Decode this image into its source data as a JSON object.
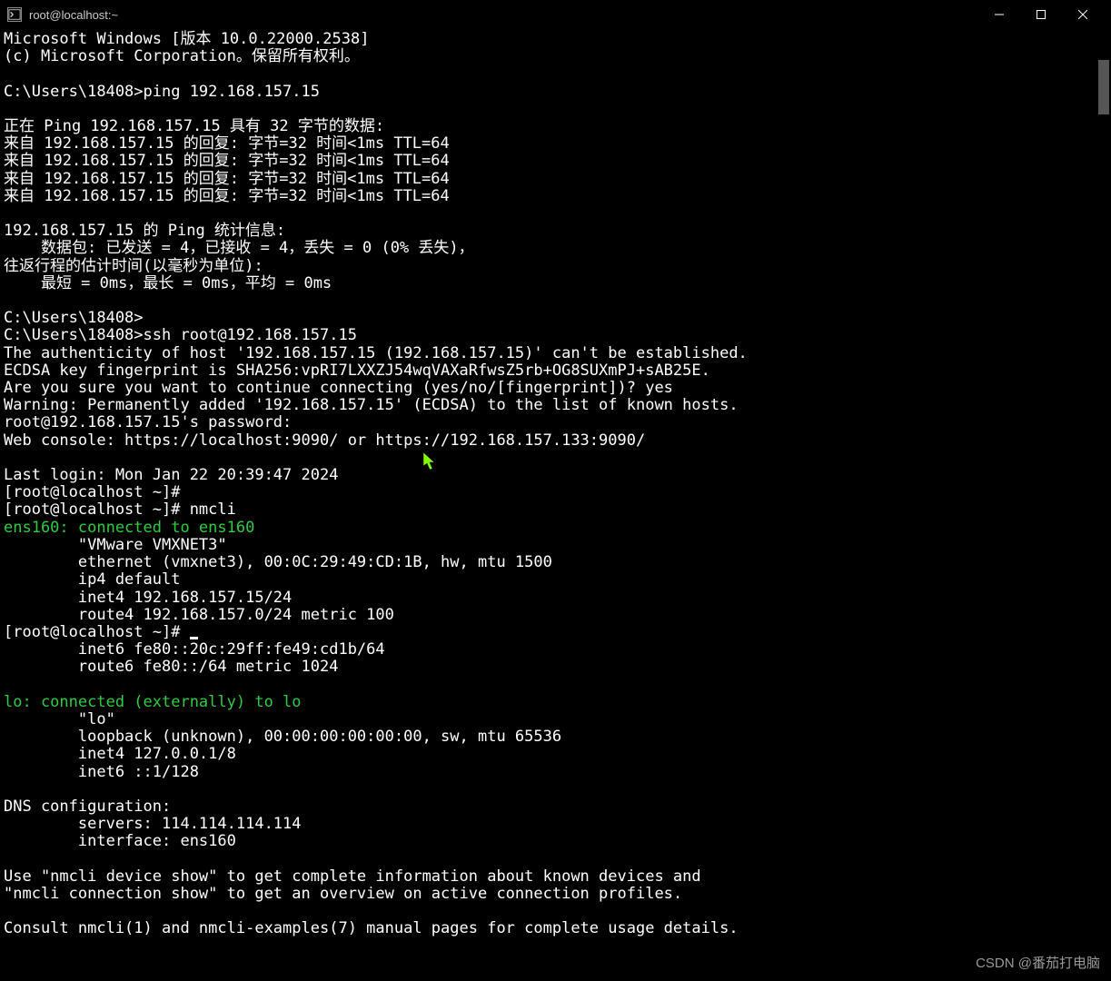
{
  "titlebar": {
    "icon_label": "cmd",
    "title": "root@localhost:~"
  },
  "faded_background": "番茄打电脑",
  "terminal_lines": [
    {
      "text": "Microsoft Windows [版本 10.0.22000.2538]",
      "cls": ""
    },
    {
      "text": "(c) Microsoft Corporation。保留所有权利。",
      "cls": ""
    },
    {
      "text": "",
      "cls": ""
    },
    {
      "text": "C:\\Users\\18408>ping 192.168.157.15",
      "cls": ""
    },
    {
      "text": "",
      "cls": ""
    },
    {
      "text": "正在 Ping 192.168.157.15 具有 32 字节的数据:",
      "cls": ""
    },
    {
      "text": "来自 192.168.157.15 的回复: 字节=32 时间<1ms TTL=64",
      "cls": ""
    },
    {
      "text": "来自 192.168.157.15 的回复: 字节=32 时间<1ms TTL=64",
      "cls": ""
    },
    {
      "text": "来自 192.168.157.15 的回复: 字节=32 时间<1ms TTL=64",
      "cls": ""
    },
    {
      "text": "来自 192.168.157.15 的回复: 字节=32 时间<1ms TTL=64",
      "cls": ""
    },
    {
      "text": "",
      "cls": ""
    },
    {
      "text": "192.168.157.15 的 Ping 统计信息:",
      "cls": ""
    },
    {
      "text": "    数据包: 已发送 = 4，已接收 = 4，丢失 = 0 (0% 丢失)，",
      "cls": ""
    },
    {
      "text": "往返行程的估计时间(以毫秒为单位):",
      "cls": ""
    },
    {
      "text": "    最短 = 0ms，最长 = 0ms，平均 = 0ms",
      "cls": ""
    },
    {
      "text": "",
      "cls": ""
    },
    {
      "text": "C:\\Users\\18408>",
      "cls": ""
    },
    {
      "text": "C:\\Users\\18408>ssh root@192.168.157.15",
      "cls": ""
    },
    {
      "text": "The authenticity of host '192.168.157.15 (192.168.157.15)' can't be established.",
      "cls": ""
    },
    {
      "text": "ECDSA key fingerprint is SHA256:vpRI7LXXZJ54wqVAXaRfwsZ5rb+OG8SUXmPJ+sAB25E.",
      "cls": ""
    },
    {
      "text": "Are you sure you want to continue connecting (yes/no/[fingerprint])? yes",
      "cls": ""
    },
    {
      "text": "Warning: Permanently added '192.168.157.15' (ECDSA) to the list of known hosts.",
      "cls": ""
    },
    {
      "text": "root@192.168.157.15's password:",
      "cls": ""
    },
    {
      "text": "Web console: https://localhost:9090/ or https://192.168.157.133:9090/",
      "cls": ""
    },
    {
      "text": "",
      "cls": ""
    },
    {
      "text": "Last login: Mon Jan 22 20:39:47 2024",
      "cls": ""
    },
    {
      "text": "[root@localhost ~]#",
      "cls": ""
    },
    {
      "text": "[root@localhost ~]# nmcli",
      "cls": ""
    },
    {
      "text": "ens160: connected to ens160",
      "cls": "green"
    },
    {
      "text": "        \"VMware VMXNET3\"",
      "cls": ""
    },
    {
      "text": "        ethernet (vmxnet3), 00:0C:29:49:CD:1B, hw, mtu 1500",
      "cls": ""
    },
    {
      "text": "        ip4 default",
      "cls": ""
    },
    {
      "text": "        inet4 192.168.157.15/24",
      "cls": ""
    },
    {
      "text": "        route4 192.168.157.0/24 metric 100",
      "cls": ""
    },
    {
      "text": "[root@localhost ~]# ",
      "cls": "",
      "has_cursor": true
    },
    {
      "text": "        inet6 fe80::20c:29ff:fe49:cd1b/64",
      "cls": ""
    },
    {
      "text": "        route6 fe80::/64 metric 1024",
      "cls": ""
    },
    {
      "text": "",
      "cls": ""
    },
    {
      "text": "lo: connected (externally) to lo",
      "cls": "green"
    },
    {
      "text": "        \"lo\"",
      "cls": ""
    },
    {
      "text": "        loopback (unknown), 00:00:00:00:00:00, sw, mtu 65536",
      "cls": ""
    },
    {
      "text": "        inet4 127.0.0.1/8",
      "cls": ""
    },
    {
      "text": "        inet6 ::1/128",
      "cls": ""
    },
    {
      "text": "",
      "cls": ""
    },
    {
      "text": "DNS configuration:",
      "cls": ""
    },
    {
      "text": "        servers: 114.114.114.114",
      "cls": ""
    },
    {
      "text": "        interface: ens160",
      "cls": ""
    },
    {
      "text": "",
      "cls": ""
    },
    {
      "text": "Use \"nmcli device show\" to get complete information about known devices and",
      "cls": ""
    },
    {
      "text": "\"nmcli connection show\" to get an overview on active connection profiles.",
      "cls": ""
    },
    {
      "text": "",
      "cls": ""
    },
    {
      "text": "Consult nmcli(1) and nmcli-examples(7) manual pages for complete usage details.",
      "cls": ""
    }
  ],
  "watermark": "CSDN @番茄打电脑"
}
